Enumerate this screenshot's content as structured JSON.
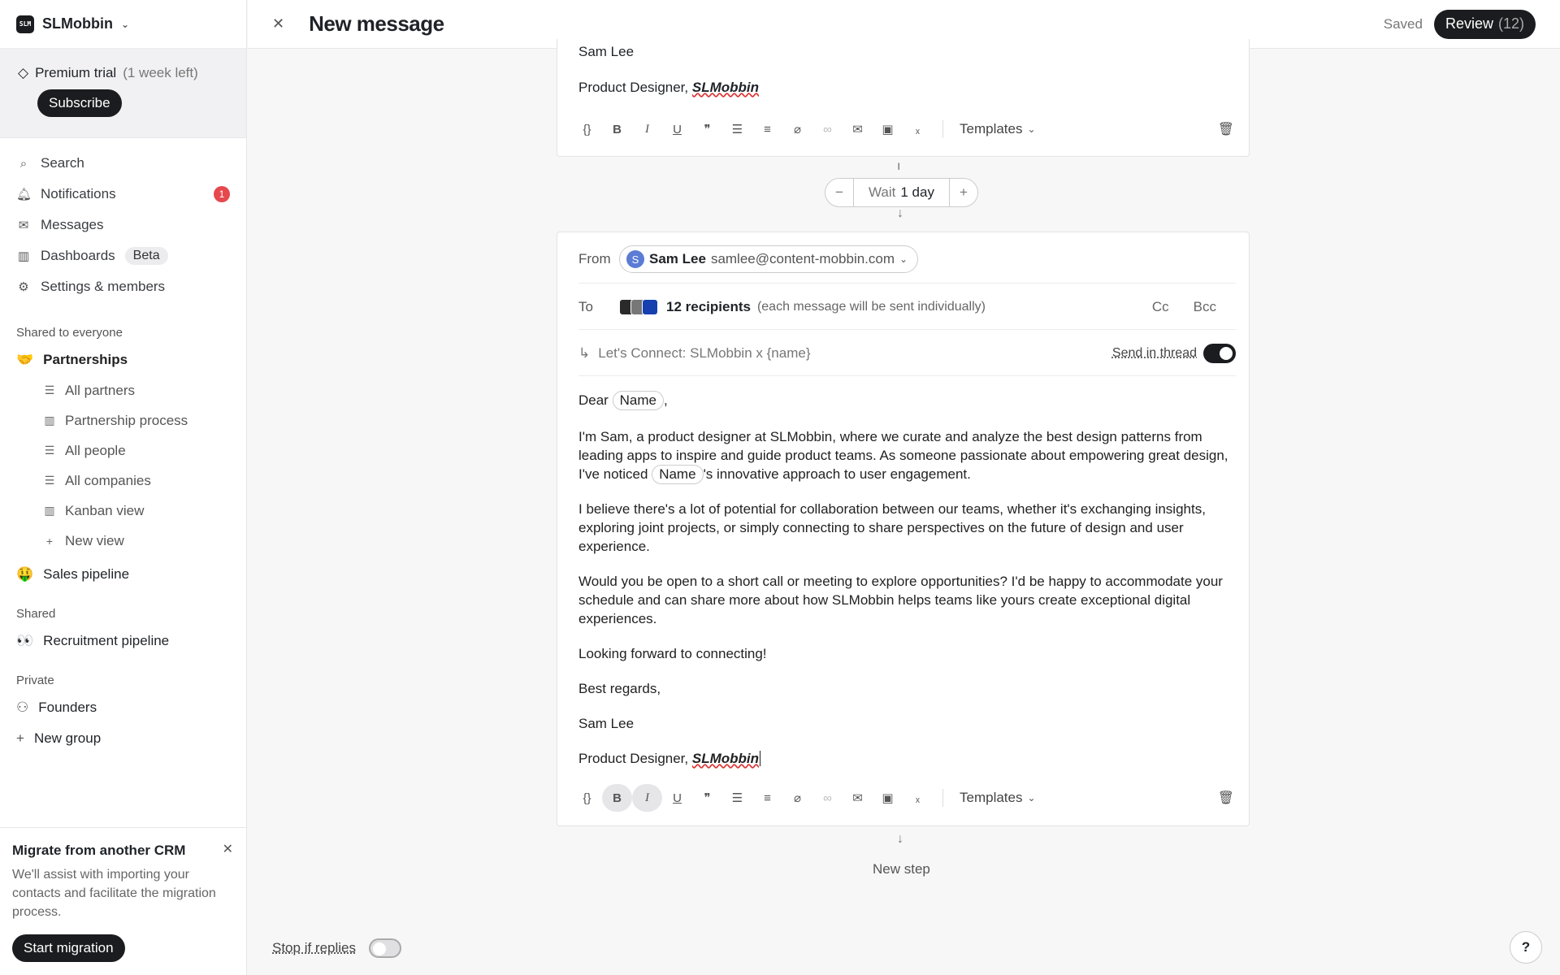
{
  "workspace": {
    "name": "SLMobbin",
    "logo_text": "SLM"
  },
  "trial": {
    "label": "Premium trial",
    "remaining": "(1 week left)",
    "subscribe": "Subscribe"
  },
  "nav": {
    "search": "Search",
    "notifications": "Notifications",
    "notifications_count": "1",
    "messages": "Messages",
    "dashboards": "Dashboards",
    "dashboards_badge": "Beta",
    "settings": "Settings & members"
  },
  "groups": {
    "shared_everyone_label": "Shared to everyone",
    "partnerships": {
      "emoji": "🤝",
      "label": "Partnerships"
    },
    "partnership_views": [
      {
        "icon": "table-icon",
        "label": "All partners"
      },
      {
        "icon": "kanban-icon",
        "label": "Partnership process"
      },
      {
        "icon": "table-icon",
        "label": "All people"
      },
      {
        "icon": "table-icon",
        "label": "All companies"
      },
      {
        "icon": "kanban-icon",
        "label": "Kanban view"
      },
      {
        "icon": "plus-icon",
        "label": "New view"
      }
    ],
    "sales": {
      "emoji": "🤑",
      "label": "Sales pipeline"
    },
    "shared_label": "Shared",
    "recruitment": {
      "emoji": "👀",
      "label": "Recruitment pipeline"
    },
    "private_label": "Private",
    "founders": {
      "label": "Founders"
    },
    "new_group": "New group"
  },
  "migrate": {
    "title": "Migrate from another CRM",
    "desc": "We'll assist with importing your contacts and facilitate the migration process.",
    "button": "Start migration"
  },
  "topbar": {
    "title": "New message",
    "saved": "Saved",
    "review": "Review",
    "review_count": "(12)"
  },
  "prev_step": {
    "signature_name": "Sam Lee",
    "signature_title": "Product Designer,",
    "signature_brand": "SLMobbin"
  },
  "toolbar": {
    "templates": "Templates"
  },
  "wait": {
    "prefix": "Wait",
    "value": "1 day"
  },
  "email": {
    "from_label": "From",
    "from_initial": "S",
    "from_name": "Sam Lee",
    "from_email": "samlee@content-mobbin.com",
    "to_label": "To",
    "recipients": "12 recipients",
    "recipients_note": "(each message will be sent individually)",
    "cc": "Cc",
    "bcc": "Bcc",
    "subject": "Let's Connect: SLMobbin x {name}",
    "send_in_thread": "Send in thread",
    "greeting": "Dear",
    "name_chip": "Name",
    "p1_a": "I'm Sam, a product designer at SLMobbin, where we curate and analyze the best design patterns from leading apps to inspire and guide product teams. As someone passionate about empowering great design, I've noticed",
    "p1_b": "'s innovative approach to user engagement.",
    "p2": "I believe there's a lot of potential for collaboration between our teams, whether it's exchanging insights, exploring joint projects, or simply connecting to share perspectives on the future of design and user experience.",
    "p3": "Would you be open to a short call or meeting to explore opportunities? I'd be happy to accommodate your schedule and can share more about how SLMobbin helps teams like yours create exceptional digital experiences.",
    "p4": "Looking forward to connecting!",
    "p5": "Best regards,",
    "sig_name": "Sam Lee",
    "sig_title": "Product Designer,",
    "sig_brand": "SLMobbin"
  },
  "new_step": "New step",
  "stop_if_replies": "Stop if replies",
  "help": "?"
}
